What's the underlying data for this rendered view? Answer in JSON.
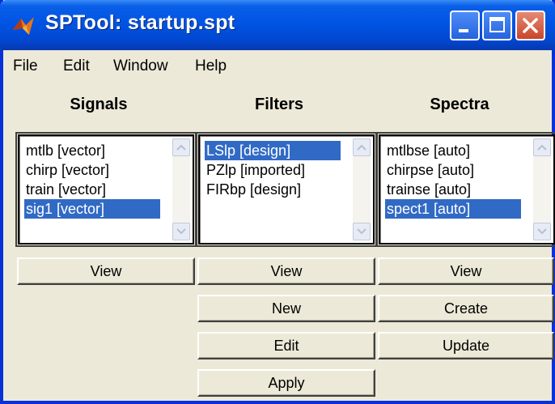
{
  "window": {
    "title": "SPTool: startup.spt"
  },
  "menu": [
    "File",
    "Edit",
    "Window",
    "Help"
  ],
  "columns": {
    "signals": {
      "heading": "Signals",
      "items": [
        "mtlb [vector]",
        "chirp [vector]",
        "train [vector]",
        "sig1 [vector]"
      ],
      "selected_index": 3,
      "buttons": [
        "View"
      ]
    },
    "filters": {
      "heading": "Filters",
      "items": [
        "LSlp [design]",
        "PZlp [imported]",
        "FIRbp [design]"
      ],
      "selected_index": 0,
      "buttons": [
        "View",
        "New",
        "Edit",
        "Apply"
      ]
    },
    "spectra": {
      "heading": "Spectra",
      "items": [
        "mtlbse [auto]",
        "chirpse [auto]",
        "trainse [auto]",
        "spect1 [auto]"
      ],
      "selected_index": 3,
      "buttons": [
        "View",
        "Create",
        "Update"
      ]
    }
  },
  "colors": {
    "titlebar": "#0054e3",
    "selection": "#316ac5",
    "face": "#ece9d8"
  }
}
